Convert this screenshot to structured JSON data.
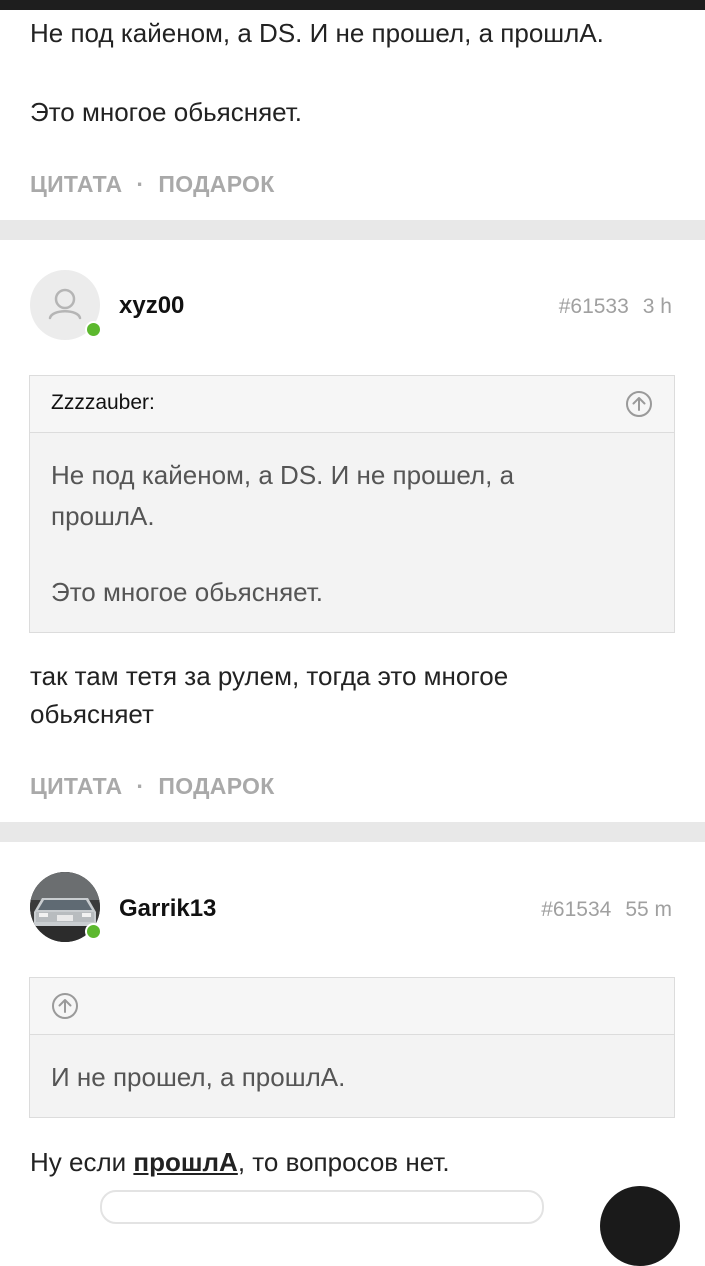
{
  "post_prev": {
    "line1": "Не под кайеном, а DS. И не прошел, а прошлА.",
    "line2": "Это многое обьясняет.",
    "quote_action": "ЦИТАТА",
    "gift_action": "ПОДАРОК",
    "separator": "·"
  },
  "post_1": {
    "username": "xyz00",
    "post_number": "#61533",
    "time": "3 h",
    "quote": {
      "author": "Zzzzauber:",
      "line1": "Не под кайеном, а DS. И не прошел, а прошлА.",
      "line2": "Это многое обьясняет."
    },
    "text": "так там тетя за рулем, тогда это многое обьясняет",
    "quote_action": "ЦИТАТА",
    "gift_action": "ПОДАРОК",
    "separator": "·"
  },
  "post_2": {
    "username": "Garrik13",
    "post_number": "#61534",
    "time": "55 m",
    "quote": {
      "author": "",
      "text": "И не прошел, а прошлА."
    },
    "text_before": "Ну если ",
    "text_bold": "прошлА",
    "text_after": ", то вопросов нет."
  },
  "colors": {
    "online": "#5cb82e",
    "actions": "#a9a9a9",
    "divider": "#e8e8e8"
  }
}
